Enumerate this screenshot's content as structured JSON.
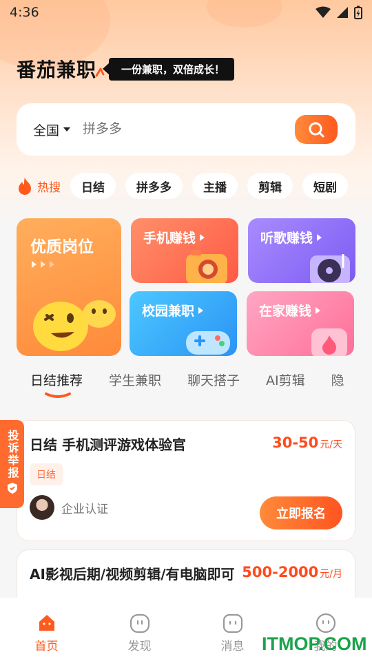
{
  "status_bar": {
    "time": "4:36"
  },
  "brand": {
    "logo": "番茄兼职",
    "slogan": "一份兼职，双倍成长！"
  },
  "search": {
    "region": "全国",
    "placeholder": "拼多多"
  },
  "hot": {
    "label": "热搜",
    "tags": [
      "日结",
      "拼多多",
      "主播",
      "剪辑",
      "短剧"
    ]
  },
  "categories": {
    "featured": "优质岗位",
    "cards": [
      "手机赚钱",
      "听歌赚钱",
      "校园兼职",
      "在家赚钱"
    ]
  },
  "tabs": [
    "日结推荐",
    "学生兼职",
    "聊天搭子",
    "AI剪辑",
    "隐"
  ],
  "report_badge": "投诉举报",
  "jobs": [
    {
      "title": "日结 手机测评游戏体验官",
      "salary": "30-50",
      "unit": "元/天",
      "tag": "日结",
      "company": "企业认证",
      "action": "立即报名"
    },
    {
      "title": "AI影视后期/视频剪辑/有电脑即可",
      "salary": "500-2000",
      "unit": "元/月"
    }
  ],
  "bottom_nav": [
    "首页",
    "发现",
    "消息",
    "我的"
  ],
  "watermark": "ITMOP.COM",
  "colors": {
    "accent": "#ff5a1e",
    "watermark": "#1aa34a"
  }
}
